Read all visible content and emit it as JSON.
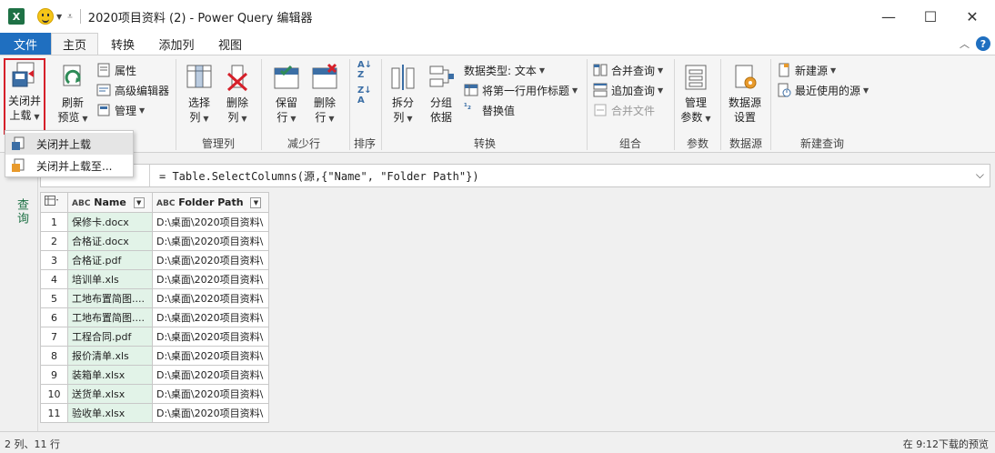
{
  "window": {
    "title": "2020项目资料 (2) - Power Query 编辑器",
    "app_logo": "X"
  },
  "tabs": {
    "file": "文件",
    "items": [
      "主页",
      "转换",
      "添加列",
      "视图"
    ]
  },
  "ribbon": {
    "close_load": {
      "line1": "关闭并",
      "line2": "上载"
    },
    "refresh": {
      "line1": "刷新",
      "line2": "预览"
    },
    "properties": "属性",
    "advanced_editor": "高级编辑器",
    "manage": "管理",
    "choose_columns": {
      "line1": "选择",
      "line2": "列"
    },
    "remove_columns": {
      "line1": "删除",
      "line2": "列"
    },
    "keep_rows": {
      "line1": "保留",
      "line2": "行"
    },
    "remove_rows": {
      "line1": "删除",
      "line2": "行"
    },
    "split_column": {
      "line1": "拆分",
      "line2": "列"
    },
    "group_by": {
      "line1": "分组",
      "line2": "依据"
    },
    "data_type": "数据类型: 文本",
    "first_row_header": "将第一行用作标题",
    "replace_values": "替换值",
    "merge_queries": "合并查询",
    "append_queries": "追加查询",
    "combine_files": "合并文件",
    "manage_params": {
      "line1": "管理",
      "line2": "参数"
    },
    "data_source_settings": {
      "line1": "数据源",
      "line2": "设置"
    },
    "new_source": "新建源",
    "recent_sources": "最近使用的源",
    "groups": {
      "manage_columns": "管理列",
      "reduce_rows": "减少行",
      "sort": "排序",
      "transform": "转换",
      "combine": "组合",
      "parameters": "参数",
      "data_source": "数据源",
      "new_query": "新建查询"
    }
  },
  "dropdown": {
    "items": [
      "关闭并上载",
      "关闭并上载至..."
    ]
  },
  "side_panel": {
    "label": "查询"
  },
  "formula": {
    "text": "= Table.SelectColumns(源,{\"Name\", \"Folder Path\"})"
  },
  "table": {
    "type_tag": "ABC",
    "columns": [
      "Name",
      "Folder Path"
    ],
    "rows": [
      {
        "idx": "1",
        "name": "保修卡.docx",
        "path": "D:\\桌面\\2020项目资料\\"
      },
      {
        "idx": "2",
        "name": "合格证.docx",
        "path": "D:\\桌面\\2020项目资料\\"
      },
      {
        "idx": "3",
        "name": "合格证.pdf",
        "path": "D:\\桌面\\2020项目资料\\"
      },
      {
        "idx": "4",
        "name": "培训单.xls",
        "path": "D:\\桌面\\2020项目资料\\"
      },
      {
        "idx": "5",
        "name": "工地布置简图....",
        "path": "D:\\桌面\\2020项目资料\\"
      },
      {
        "idx": "6",
        "name": "工地布置简图....",
        "path": "D:\\桌面\\2020项目资料\\"
      },
      {
        "idx": "7",
        "name": "工程合同.pdf",
        "path": "D:\\桌面\\2020项目资料\\"
      },
      {
        "idx": "8",
        "name": "报价清单.xls",
        "path": "D:\\桌面\\2020项目资料\\"
      },
      {
        "idx": "9",
        "name": "装箱单.xlsx",
        "path": "D:\\桌面\\2020项目资料\\"
      },
      {
        "idx": "10",
        "name": "送货单.xlsx",
        "path": "D:\\桌面\\2020项目资料\\"
      },
      {
        "idx": "11",
        "name": "验收单.xlsx",
        "path": "D:\\桌面\\2020项目资料\\"
      }
    ]
  },
  "status": {
    "left": "2 列、11 行",
    "right": "在 9:12下载的预览"
  },
  "colors": {
    "accent": "#1f6fc0",
    "excel_green": "#1e7145",
    "highlight_red": "#d6202a",
    "name_column_bg": "#e2f3e8"
  }
}
